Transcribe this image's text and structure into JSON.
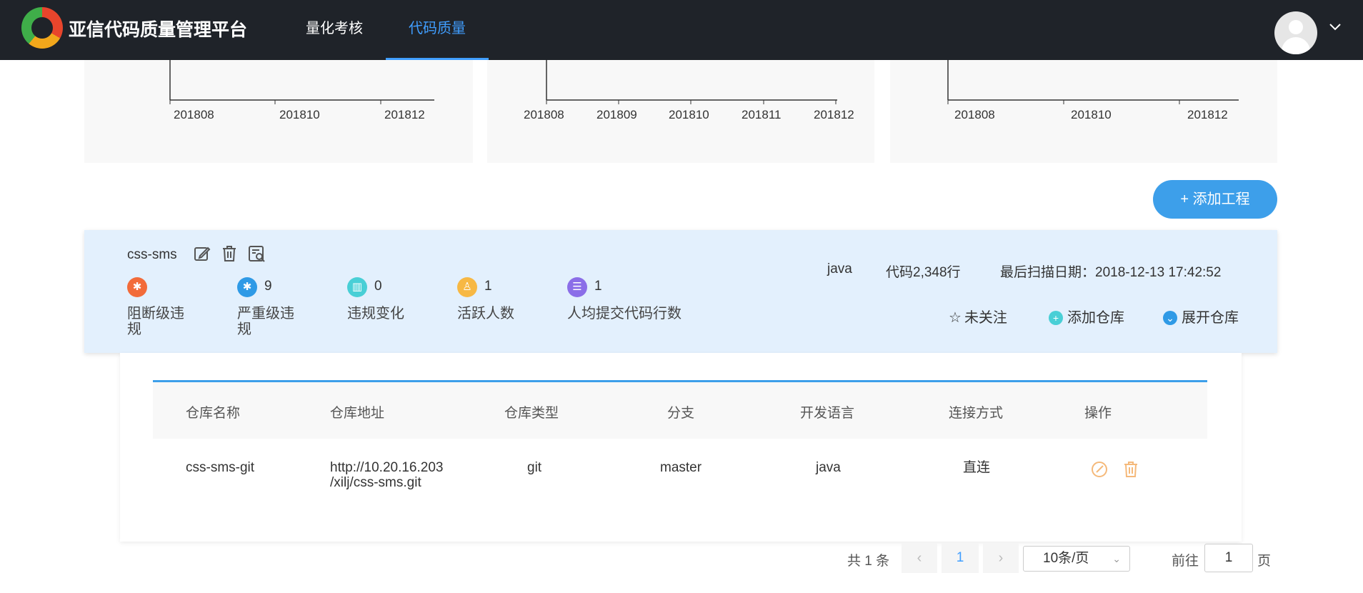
{
  "header": {
    "brand": "亚信代码质量管理平台",
    "nav": [
      {
        "label": "量化考核"
      },
      {
        "label": "代码质量"
      }
    ],
    "avatar_icon": "user-avatar-icon",
    "colors": {
      "bg": "#1f2329",
      "active": "#409eff"
    }
  },
  "charts": [
    {
      "ticks": [
        "201808",
        "201810",
        "201812"
      ]
    },
    {
      "ticks": [
        "201808",
        "201809",
        "201810",
        "201811",
        "201812"
      ]
    },
    {
      "ticks": [
        "201808",
        "201810",
        "201812"
      ]
    }
  ],
  "add_button": "+ 添加工程",
  "project": {
    "name": "css-sms",
    "tools": [
      "edit-icon",
      "trash-icon",
      "scan-report-icon"
    ],
    "metrics": [
      {
        "value": "",
        "label": "阻断级违规",
        "icon": "bug-icon",
        "color": "#f26b3a"
      },
      {
        "value": "9",
        "label": "严重级违规",
        "icon": "bug-icon",
        "color": "#2f9ae6"
      },
      {
        "value": "0",
        "label": "违规变化",
        "icon": "bar-chart-icon",
        "color": "#49cfd6"
      },
      {
        "value": "1",
        "label": "活跃人数",
        "icon": "person-icon",
        "color": "#f7b844"
      },
      {
        "value": "1",
        "label": "人均提交代码行数",
        "icon": "list-icon",
        "color": "#8b6ee8"
      }
    ],
    "language": "java",
    "code_lines": "代码2,348行",
    "last_scan": "最后扫描日期：2018-12-13 17:42:52",
    "actions": {
      "follow": "未关注",
      "add_repo": "添加仓库",
      "expand_repo": "展开仓库"
    }
  },
  "repo_table": {
    "headers": [
      "仓库名称",
      "仓库地址",
      "仓库类型",
      "分支",
      "开发语言",
      "连接方式",
      "操作"
    ],
    "rows": [
      {
        "name": "css-sms-git",
        "address_line1": "http://10.20.16.203",
        "address_line2": "/xilj/css-sms.git",
        "type": "git",
        "branch": "master",
        "language": "java",
        "connection": "直连"
      }
    ]
  },
  "pagination": {
    "total": "共 1 条",
    "current": "1",
    "page_size": "10条/页",
    "goto_label": "前往",
    "goto_value": "1",
    "page_suffix": "页"
  }
}
